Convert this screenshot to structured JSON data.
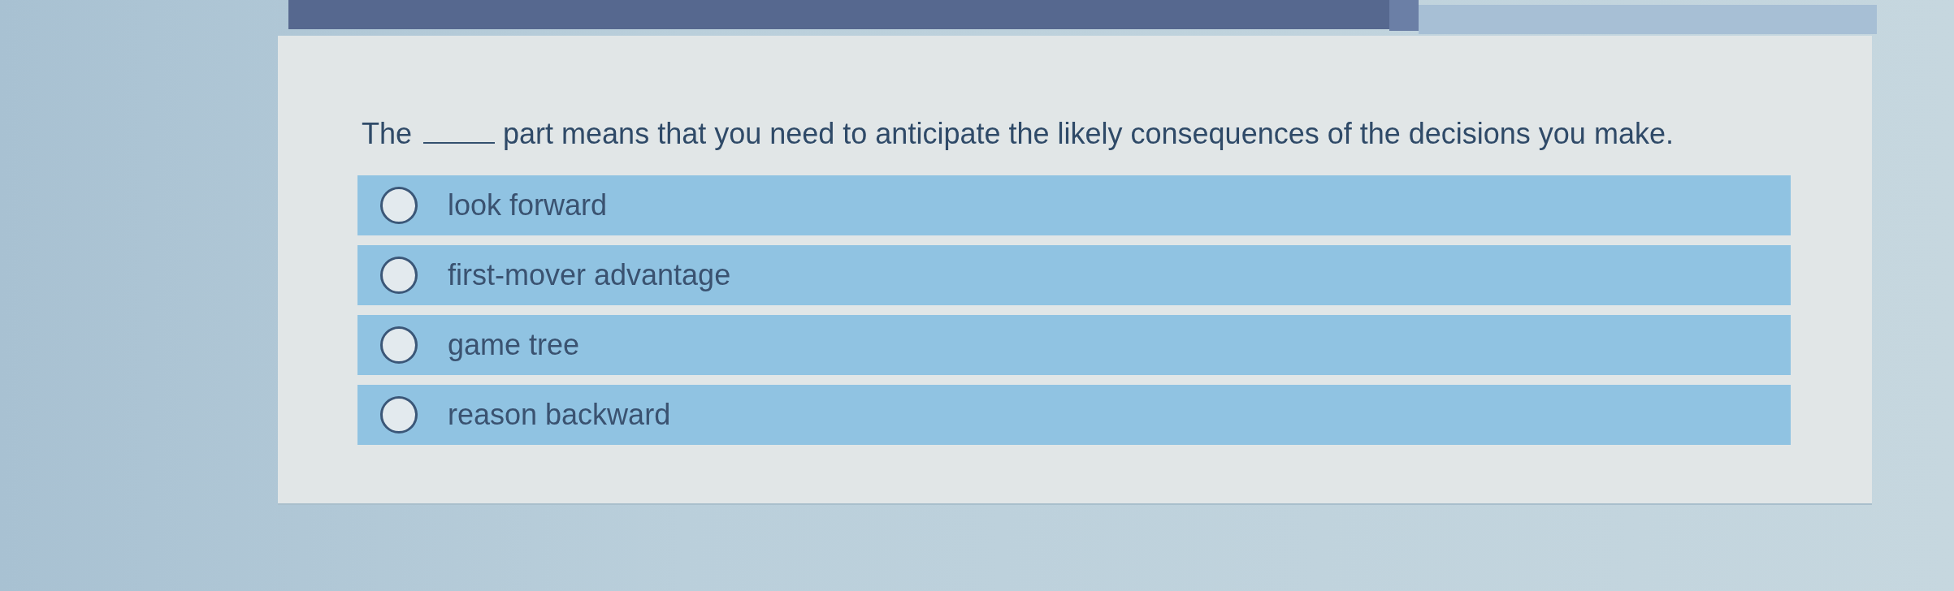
{
  "question": {
    "before": "The",
    "after": "part means that you need to anticipate the likely consequences of the decisions you make."
  },
  "options": [
    {
      "label": "look forward",
      "selected": false
    },
    {
      "label": "first-mover advantage",
      "selected": false
    },
    {
      "label": "game tree",
      "selected": false
    },
    {
      "label": "reason backward",
      "selected": false
    }
  ]
}
